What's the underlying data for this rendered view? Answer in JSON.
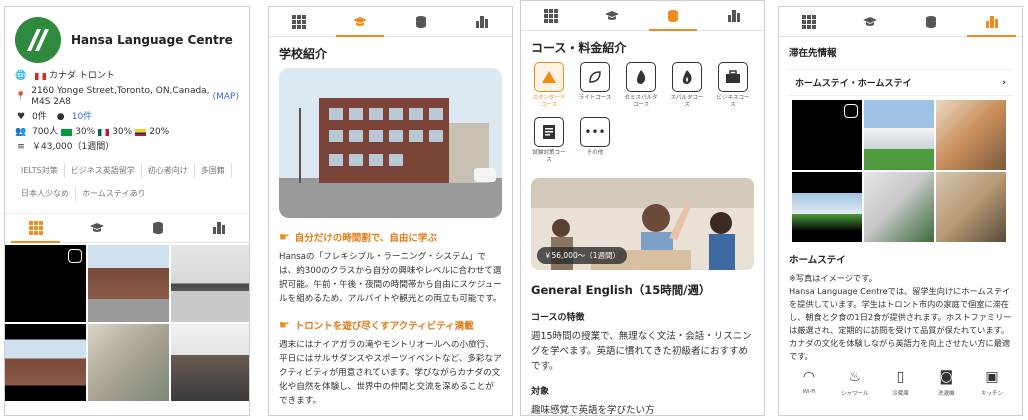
{
  "school": {
    "name": "Hansa Language Centre",
    "country": "カナダ トロント",
    "address": "2160 Yonge Street,Toronto, ON,Canada, M4S 2A8",
    "map_label": "(MAP)",
    "likes": "0件",
    "comments": "10件",
    "students": "700人",
    "nat1_pct": "30%",
    "nat2_pct": "30%",
    "nat3_pct": "20%",
    "price": "￥43,000（1週間）",
    "tags": [
      "IELTS対策",
      "ビジネス英語留学",
      "初心者向け",
      "多国籍",
      "日本人少なめ",
      "ホームステイあり"
    ]
  },
  "tabs": [
    {
      "icon": "grid-icon"
    },
    {
      "icon": "graduation-cap-icon"
    },
    {
      "icon": "coins-icon"
    },
    {
      "icon": "building-icon"
    }
  ],
  "intro": {
    "title": "学校紹介",
    "h1": "自分だけの時間割で、自由に学ぶ",
    "p1": "Hansaの「フレキシブル・ラーニング・システム」では、約300のクラスから自分の興味やレベルに合わせて選択可能。午前・午後・夜間の時間帯から自由にスケジュールを組めるため、アルバイトや観光との両立も可能です。",
    "h2": "トロントを遊び尽くすアクティビティ満載",
    "p2": "週末にはナイアガラの滝やモントリオールへの小旅行、平日にはサルサダンスやスポーツイベントなど、多彩なアクティビティが用意されています。学びながらカナダの文化や自然を体験し、世界中の仲間と交流を深めることができます。"
  },
  "courses": {
    "title": "コース・料金紹介",
    "items": [
      {
        "label": "スタンダードコース",
        "icon": "pyramid-icon",
        "active": true
      },
      {
        "label": "ライトコース",
        "icon": "leaf-icon",
        "active": false
      },
      {
        "label": "セミスパルタコース",
        "icon": "flame-icon",
        "active": false
      },
      {
        "label": "スパルタコース",
        "icon": "fire-icon",
        "active": false
      },
      {
        "label": "ビジネスコース",
        "icon": "briefcase-icon",
        "active": false
      },
      {
        "label": "試験対策コース",
        "icon": "exam-icon",
        "active": false
      },
      {
        "label": "その他",
        "icon": "more-icon",
        "active": false
      }
    ],
    "price_badge": "￥56,000～（1週間）",
    "course_title": "General English（15時間/週）",
    "feature_h": "コースの特徴",
    "feature_text": "週15時間の授業で、無理なく文法・会話・リスニングを学べます。英語に慣れてきた初級者におすすめです。",
    "target_h": "対象",
    "target_text": "趣味感覚で英語を学びたい方"
  },
  "stay": {
    "title": "滞在先情報",
    "option": "ホームステイ・ホームステイ",
    "section": "ホームステイ",
    "note": "※写真はイメージです。",
    "desc": "Hansa Language Centreでは、留学生向けにホームステイを提供しています。学生はトロント市内の家庭で個室に滞在し、朝食と夕食の1日2食が提供されます。ホストファミリーは厳選され、定期的に訪問を受けて品質が保たれています。カナダの文化を体験しながら英語力を向上させたい方に最適です。",
    "amenities": [
      {
        "label": "Wi-Fi",
        "icon": "wifi-icon"
      },
      {
        "label": "シャワール",
        "icon": "shower-icon"
      },
      {
        "label": "冷蔵庫",
        "icon": "fridge-icon"
      },
      {
        "label": "洗濯機",
        "icon": "washer-icon"
      },
      {
        "label": "キッチン",
        "icon": "kitchen-icon"
      }
    ]
  },
  "colors": {
    "accent": "#f08c1e",
    "link": "#3a6fd8",
    "logo": "#2f8a3f"
  }
}
